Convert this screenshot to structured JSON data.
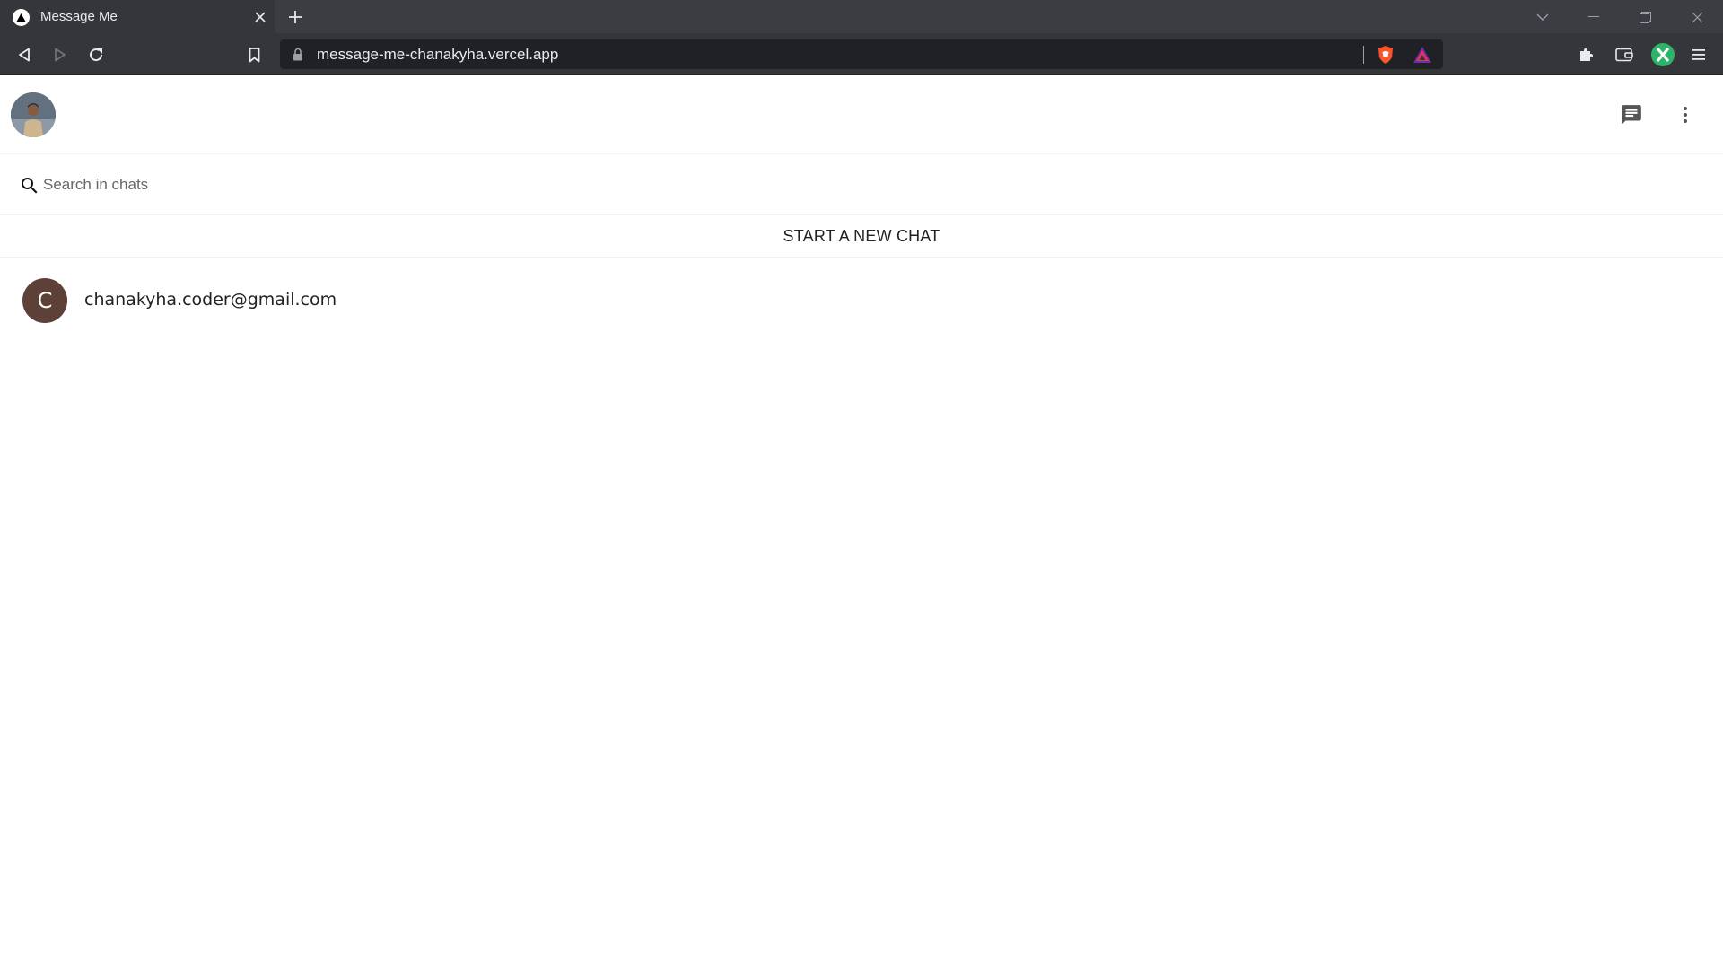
{
  "browser": {
    "tab": {
      "title": "Message Me",
      "favicon": "vercel-triangle-icon"
    },
    "address_bar": {
      "url": "message-me-chanakyha.vercel.app"
    },
    "icons": {
      "back": "back-icon",
      "forward": "forward-icon",
      "reload": "reload-icon",
      "bookmark": "bookmark-icon",
      "lock": "lock-icon",
      "brave_shield": "brave-shield-icon",
      "brave_rewards": "brave-rewards-icon",
      "extensions": "puzzle-icon",
      "wallet": "wallet-icon",
      "profile": "profile-icon",
      "menu": "menu-icon"
    },
    "colors": {
      "tabstrip": "#3c3c43",
      "toolbar": "#35363a",
      "omnibox": "#202124",
      "brave_orange": "#fb542b"
    }
  },
  "app": {
    "header": {
      "new_chat_icon": "chat-icon",
      "more_icon": "more-vert-icon"
    },
    "search": {
      "placeholder": "Search in chats",
      "value": ""
    },
    "new_chat_label": "START A NEW CHAT",
    "chats": [
      {
        "initial": "C",
        "email": "chanakyha.coder@gmail.com",
        "avatar_color": "#5d4037"
      }
    ]
  }
}
